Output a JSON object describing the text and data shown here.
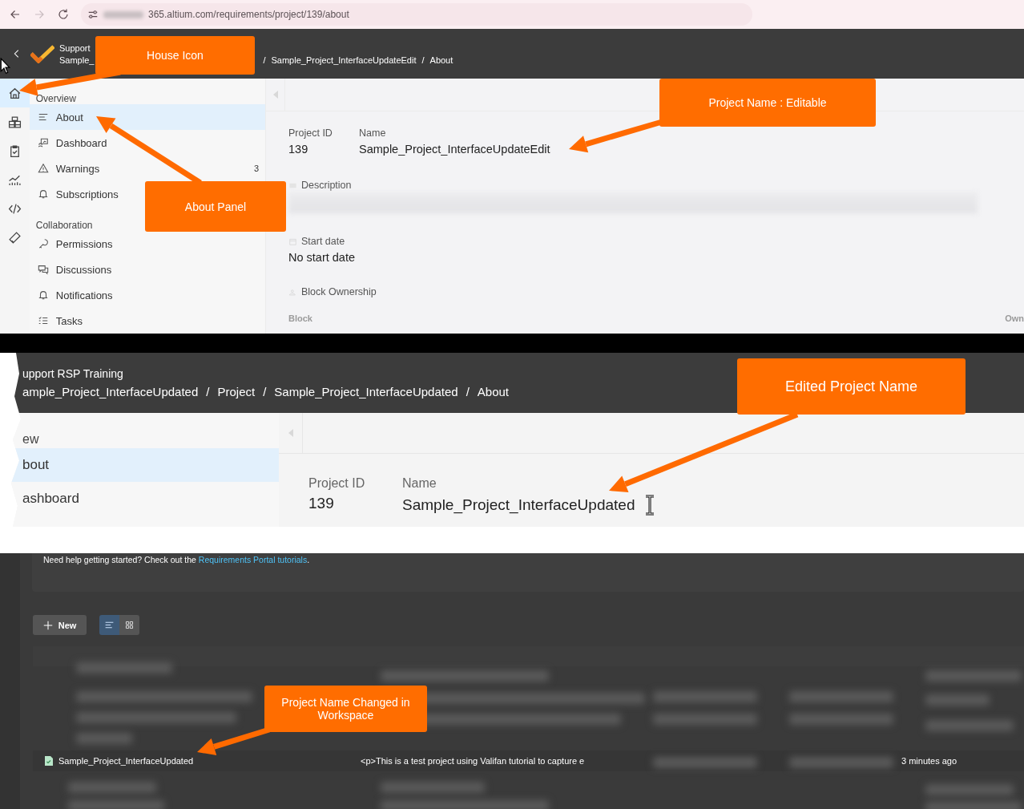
{
  "browser": {
    "nav": [
      {
        "kind": "back",
        "disabled": false
      },
      {
        "kind": "forward",
        "disabled": true
      },
      {
        "kind": "reload",
        "disabled": false
      }
    ],
    "url": "365.altium.com/requirements/project/139/about"
  },
  "panel_1": {
    "header": {
      "workspace": "Support",
      "project": "Sample_",
      "breadcrumbs": [
        "/",
        "Sample_Project_InterfaceUpdateEdit",
        "/",
        "About"
      ]
    },
    "rail": [
      {
        "kind": "home",
        "selected": true
      },
      {
        "kind": "components",
        "selected": false
      },
      {
        "kind": "clipboard",
        "selected": false
      },
      {
        "kind": "chart",
        "selected": false
      },
      {
        "kind": "code",
        "selected": false
      },
      {
        "kind": "tool",
        "selected": false
      }
    ],
    "sidebar": [
      {
        "title": "Overview",
        "items": [
          {
            "label": "About",
            "kind": "lines",
            "selected": true
          },
          {
            "label": "Dashboard",
            "kind": "dashboard",
            "selected": false
          },
          {
            "label": "Warnings",
            "kind": "warning",
            "selected": false,
            "count": "3"
          },
          {
            "label": "Subscriptions",
            "kind": "bell",
            "selected": false
          }
        ]
      },
      {
        "title": "Collaboration",
        "items": [
          {
            "label": "Permissions",
            "kind": "key",
            "selected": false
          },
          {
            "label": "Discussions",
            "kind": "chat",
            "selected": false
          },
          {
            "label": "Notifications",
            "kind": "bell",
            "selected": false
          },
          {
            "label": "Tasks",
            "kind": "list",
            "selected": false
          }
        ]
      }
    ],
    "about": {
      "project_id_label": "Project ID",
      "project_id": "139",
      "name_label": "Name",
      "name": "Sample_Project_InterfaceUpdateEdit",
      "description_label": "Description",
      "start_date_label": "Start date",
      "start_date": "No start date",
      "block_ownership_label": "Block Ownership",
      "table_columns": [
        "Block",
        "Own"
      ]
    }
  },
  "panel_2": {
    "header": {
      "workspace": "upport RSP Training",
      "breadcrumbs": [
        "ample_Project_InterfaceUpdated",
        "/",
        "Project",
        "/",
        "Sample_Project_InterfaceUpdated",
        "/",
        "About"
      ]
    },
    "sidebar": {
      "title": "ew",
      "items": [
        {
          "label": "bout",
          "selected": true
        },
        {
          "label": "ashboard",
          "selected": false
        }
      ]
    },
    "about": {
      "project_id_label": "Project ID",
      "project_id": "139",
      "name_label": "Name",
      "name": "Sample_Project_InterfaceUpdated"
    }
  },
  "panel_3": {
    "help_text": "Need help getting started? Check out the ",
    "help_link": "Requirements Portal tutorials",
    "help_end": ".",
    "new_button": "New",
    "views": [
      {
        "kind": "list",
        "selected": true
      },
      {
        "kind": "grid",
        "selected": false
      }
    ],
    "row": {
      "name": "Sample_Project_InterfaceUpdated",
      "description": "<p>This is a test project using Valifan tutorial to capture e",
      "modified": "3 minutes ago"
    }
  },
  "callouts": [
    {
      "text": "House Icon"
    },
    {
      "text": "About Panel"
    },
    {
      "text": "Project Name : Editable"
    },
    {
      "text": "Edited Project Name"
    },
    {
      "text": "Project Name Changed in Workspace"
    }
  ]
}
